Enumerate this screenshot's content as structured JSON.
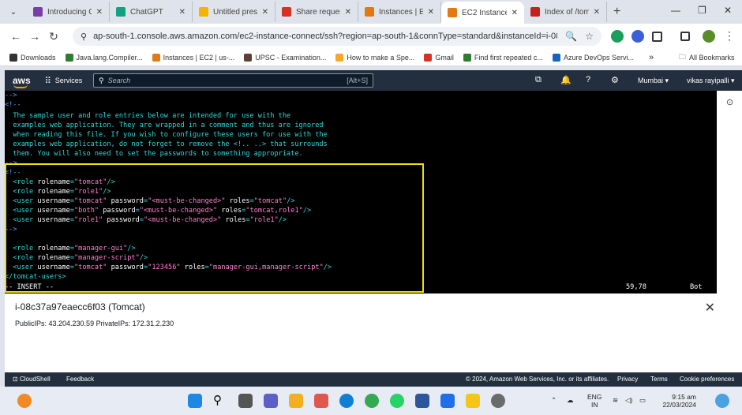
{
  "browser": {
    "tabs": [
      {
        "title": "Introducing C",
        "color": "#7a3ea8"
      },
      {
        "title": "ChatGPT",
        "color": "#10a37f"
      },
      {
        "title": "Untitled prese",
        "color": "#f4b400"
      },
      {
        "title": "Share request",
        "color": "#d93025"
      },
      {
        "title": "Instances | EC",
        "color": "#e47911"
      },
      {
        "title": "EC2 Instance",
        "color": "#e47911"
      },
      {
        "title": "Index of /tom",
        "color": "#c5221f"
      }
    ],
    "url": "ap-south-1.console.aws.amazon.com/ec2-instance-connect/ssh?region=ap-south-1&connType=standard&instanceId=i-08c37a9...",
    "bookmarks": [
      {
        "label": "Downloads",
        "color": "#333333"
      },
      {
        "label": "Java.lang.Compiler...",
        "color": "#2e7d32"
      },
      {
        "label": "Instances | EC2 | us-...",
        "color": "#e47911"
      },
      {
        "label": "UPSC - Examination...",
        "color": "#5d4037"
      },
      {
        "label": "How to make a Spe...",
        "color": "#f9a825"
      },
      {
        "label": "Gmail",
        "color": "#d93025"
      },
      {
        "label": "Find first repeated c...",
        "color": "#2e7d32"
      },
      {
        "label": "Azure DevOps Servi...",
        "color": "#1565c0"
      }
    ],
    "all_bookmarks": "All Bookmarks"
  },
  "aws": {
    "logo": "aws",
    "services": "Services",
    "search_placeholder": "Search",
    "search_shortcut": "[Alt+S]",
    "region": "Mumbai ▾",
    "user": "vikas rayipalli ▾"
  },
  "terminal": {
    "lines": [
      [
        {
          "t": "-->",
          "c": "c-blue"
        }
      ],
      [
        {
          "t": "<!--",
          "c": "c-blue"
        }
      ],
      [
        {
          "t": "  The sample user and role entries below are intended for use with the",
          "c": ""
        }
      ],
      [
        {
          "t": "  examples web application. They are wrapped in a comment and thus are ignored",
          "c": ""
        }
      ],
      [
        {
          "t": "  when reading this file. If you wish to configure these users for use with the",
          "c": ""
        }
      ],
      [
        {
          "t": "  examples web application, do not forget to remove the <!.. ..> that surrounds",
          "c": ""
        }
      ],
      [
        {
          "t": "  them. You will also need to set the passwords to something appropriate.",
          "c": ""
        }
      ],
      [
        {
          "t": "-->",
          "c": "c-blue"
        }
      ],
      [
        {
          "t": "<!--",
          "c": "c-blue"
        }
      ],
      [
        {
          "t": "  <role ",
          "c": ""
        },
        {
          "t": "rolename",
          "c": "c-white"
        },
        {
          "t": "=",
          "c": ""
        },
        {
          "t": "\"tomcat\"",
          "c": "c-pink"
        },
        {
          "t": "/>",
          "c": ""
        }
      ],
      [
        {
          "t": "  <role ",
          "c": ""
        },
        {
          "t": "rolename",
          "c": "c-white"
        },
        {
          "t": "=",
          "c": ""
        },
        {
          "t": "\"role1\"",
          "c": "c-pink"
        },
        {
          "t": "/>",
          "c": ""
        }
      ],
      [
        {
          "t": "  <user ",
          "c": ""
        },
        {
          "t": "username",
          "c": "c-white"
        },
        {
          "t": "=",
          "c": ""
        },
        {
          "t": "\"tomcat\"",
          "c": "c-pink"
        },
        {
          "t": " ",
          "c": ""
        },
        {
          "t": "password",
          "c": "c-white"
        },
        {
          "t": "=",
          "c": ""
        },
        {
          "t": "\"<must-be-changed>\"",
          "c": "c-pink"
        },
        {
          "t": " ",
          "c": ""
        },
        {
          "t": "roles",
          "c": "c-white"
        },
        {
          "t": "=",
          "c": ""
        },
        {
          "t": "\"tomcat\"",
          "c": "c-pink"
        },
        {
          "t": "/>",
          "c": ""
        }
      ],
      [
        {
          "t": "  <user ",
          "c": ""
        },
        {
          "t": "username",
          "c": "c-white"
        },
        {
          "t": "=",
          "c": ""
        },
        {
          "t": "\"both\"",
          "c": "c-pink"
        },
        {
          "t": " ",
          "c": ""
        },
        {
          "t": "password",
          "c": "c-white"
        },
        {
          "t": "=",
          "c": ""
        },
        {
          "t": "\"<must-be-changed>\"",
          "c": "c-pink"
        },
        {
          "t": " ",
          "c": ""
        },
        {
          "t": "roles",
          "c": "c-white"
        },
        {
          "t": "=",
          "c": ""
        },
        {
          "t": "\"tomcat,role1\"",
          "c": "c-pink"
        },
        {
          "t": "/>",
          "c": ""
        }
      ],
      [
        {
          "t": "  <user ",
          "c": ""
        },
        {
          "t": "username",
          "c": "c-white"
        },
        {
          "t": "=",
          "c": ""
        },
        {
          "t": "\"role1\"",
          "c": "c-pink"
        },
        {
          "t": " ",
          "c": ""
        },
        {
          "t": "password",
          "c": "c-white"
        },
        {
          "t": "=",
          "c": ""
        },
        {
          "t": "\"<must-be-changed>\"",
          "c": "c-pink"
        },
        {
          "t": " ",
          "c": ""
        },
        {
          "t": "roles",
          "c": "c-white"
        },
        {
          "t": "=",
          "c": ""
        },
        {
          "t": "\"role1\"",
          "c": "c-pink"
        },
        {
          "t": "/>",
          "c": ""
        }
      ],
      [
        {
          "t": "-->",
          "c": "c-blue"
        }
      ],
      [
        {
          "t": "",
          "c": ""
        }
      ],
      [
        {
          "t": "  <role ",
          "c": ""
        },
        {
          "t": "rolename",
          "c": "c-white"
        },
        {
          "t": "=",
          "c": ""
        },
        {
          "t": "\"manager-gui\"",
          "c": "c-pink"
        },
        {
          "t": "/>",
          "c": ""
        }
      ],
      [
        {
          "t": "  <role ",
          "c": ""
        },
        {
          "t": "rolename",
          "c": "c-white"
        },
        {
          "t": "=",
          "c": ""
        },
        {
          "t": "\"manager-script\"",
          "c": "c-pink"
        },
        {
          "t": "/>",
          "c": ""
        }
      ],
      [
        {
          "t": "  <user ",
          "c": ""
        },
        {
          "t": "username",
          "c": "c-white"
        },
        {
          "t": "=",
          "c": ""
        },
        {
          "t": "\"tomcat\"",
          "c": "c-pink"
        },
        {
          "t": " ",
          "c": ""
        },
        {
          "t": "password",
          "c": "c-white"
        },
        {
          "t": "=",
          "c": ""
        },
        {
          "t": "\"123456\"",
          "c": "c-pink"
        },
        {
          "t": " ",
          "c": ""
        },
        {
          "t": "roles",
          "c": "c-white"
        },
        {
          "t": "=",
          "c": ""
        },
        {
          "t": "\"manager-gui,manager-script\"",
          "c": "c-pink"
        },
        {
          "t": "/>",
          "c": ""
        }
      ],
      [
        {
          "t": "</tomcat-users>",
          "c": ""
        }
      ],
      [
        {
          "t": "-- INSERT --",
          "c": "c-white"
        }
      ]
    ],
    "cursor_pos": "59,78",
    "scroll_pos": "Bot"
  },
  "instance": {
    "title": "i-08c37a97eaecc6f03 (Tomcat)",
    "ips": "PublicIPs: 43.204.230.59    PrivateIPs: 172.31.2.230"
  },
  "footer": {
    "cloudshell": "CloudShell",
    "feedback": "Feedback",
    "copyright": "© 2024, Amazon Web Services, Inc. or its affiliates.",
    "privacy": "Privacy",
    "terms": "Terms",
    "cookies": "Cookie preferences"
  },
  "taskbar": {
    "lang": "ENG",
    "lang2": "IN",
    "time": "9:15 am",
    "date": "22/03/2024"
  }
}
